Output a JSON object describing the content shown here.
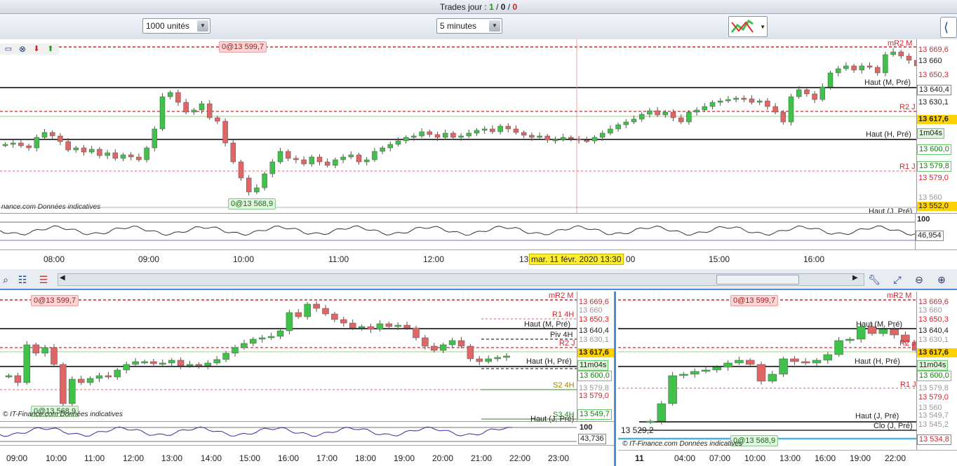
{
  "topbar": {
    "prefix": "Trades jour : ",
    "win": "1",
    "sep1": " / ",
    "zero": "0",
    "sep2": " / ",
    "loss": "0"
  },
  "toolbar": {
    "units": "1000 unités",
    "period": "5 minutes"
  },
  "main": {
    "order_tag": "0@13 599,7",
    "entry_tag": "0@13 568,9",
    "watermark": "nance.com  Données indicatives",
    "line_labels": [
      "mR2 M",
      "Haut (M, Pré)",
      "R2 J",
      "Haut (H, Pré)",
      "R1 J",
      "Haut (J, Pré)"
    ],
    "prices": [
      "13 669,6",
      "13 660",
      "13 650,3",
      "13 640,4",
      "13 630,1",
      "13 617,6",
      "1m04s",
      "13 600,0",
      "13 579,8",
      "13 579,0",
      "13 560",
      "13 552,0"
    ],
    "osc_values": [
      "100",
      "46,954"
    ],
    "times": [
      "08:00",
      "09:00",
      "10:00",
      "11:00",
      "12:00",
      "13",
      "00",
      "15:00",
      "16:00"
    ],
    "cursor_date": "mar. 11 févr. 2020 13:30"
  },
  "left": {
    "order_tag": "0@13 599,7",
    "entry_tag": "0@13 568,9",
    "watermark": "© IT-Finance.com  Données indicatives",
    "line_labels": [
      "mR2 M",
      "R1 4H",
      "Haut (M, Pré)",
      "Piv 4H",
      "R2 J",
      "Haut (H, Pré)",
      "S2 4H",
      "S3 4H",
      "Haut (J, Pré)"
    ],
    "prices": [
      "13 669,6",
      "13 660",
      "13 650,3",
      "13 640,4",
      "13 630,1",
      "13 617,6",
      "11m04s",
      "13 600,0",
      "13 579,8",
      "13 579,0",
      "13 549,7"
    ],
    "osc_values": [
      "100",
      "43,736"
    ],
    "times": [
      "09:00",
      "10:00",
      "11:00",
      "12:00",
      "13:00",
      "14:00",
      "15:00",
      "16:00",
      "17:00",
      "18:00",
      "19:00",
      "20:00",
      "21:00",
      "22:00",
      "23:00"
    ]
  },
  "right": {
    "order_tag": "0@13 599,7",
    "entry_tag": "0@13 568,9",
    "low_tag": "13 529,2",
    "watermark": "© IT-Finance.com  Données indicatives",
    "line_labels": [
      "mR2 M",
      "Haut (M, Pré)",
      "R2 J",
      "Haut (H, Pré)",
      "R1 J",
      "Haut (J, Pré)",
      "Clo (J, Pré)"
    ],
    "prices": [
      "13 669,6",
      "13 660",
      "13 650,3",
      "13 640,4",
      "13 630,1",
      "13 617,6",
      "11m04s",
      "13 600,0",
      "13 579,8",
      "13 579,0",
      "13 560",
      "13 549,7",
      "13 545,2",
      "13 534,8"
    ],
    "times": [
      "11",
      "04:00",
      "07:00",
      "10:00",
      "13:00",
      "16:00",
      "19:00",
      "22:00"
    ]
  },
  "colors": {
    "up": "#3fc14a",
    "down": "#e06666",
    "resistance": "#d9232d",
    "support": "#000000",
    "highlight": "#ffd200",
    "frame_blue": "#4a8fd6"
  },
  "icons": [
    "window-icon",
    "close-icon",
    "sell-arrow-icon",
    "buy-arrow-icon",
    "cross-hair-icon",
    "settings-icon",
    "bars-icon",
    "scroll-left-icon",
    "scroll-right-icon",
    "wrench-icon",
    "zoom-fit-icon",
    "zoom-out-icon",
    "zoom-in-icon",
    "chart-style-icon"
  ]
}
